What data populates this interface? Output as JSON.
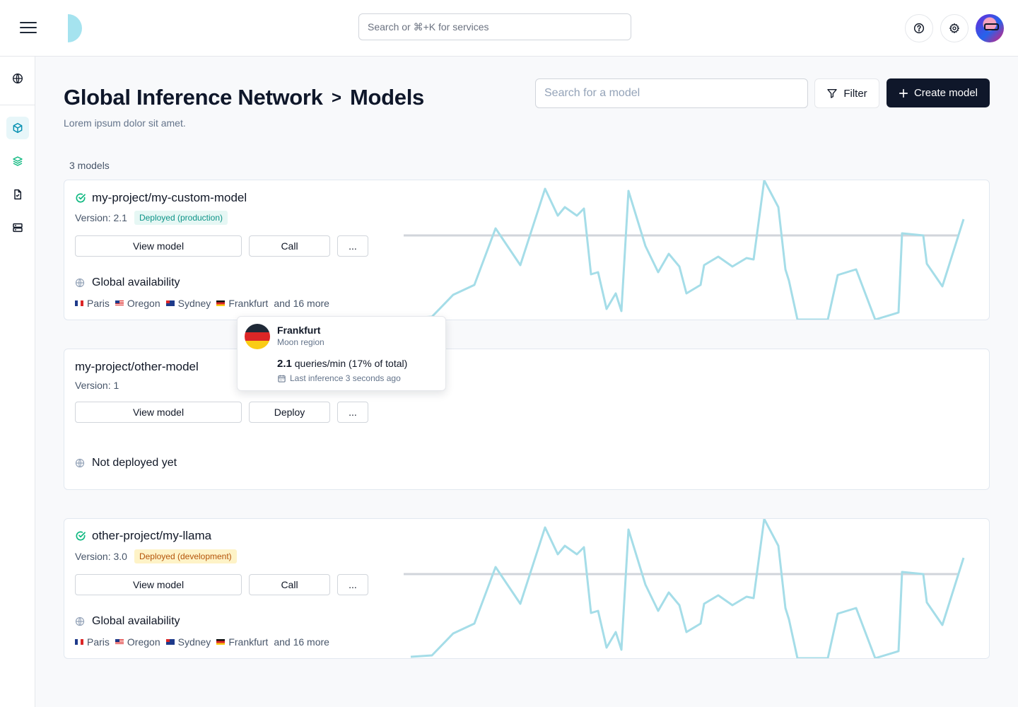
{
  "topbar": {
    "search_placeholder": "Search or ⌘+K for services"
  },
  "sidebar": {
    "items": [
      {
        "name": "globe-icon"
      },
      {
        "name": "cube-icon",
        "active": true
      },
      {
        "name": "layers-icon"
      },
      {
        "name": "file-check-icon"
      },
      {
        "name": "server-icon"
      }
    ]
  },
  "header": {
    "title_prefix": "Global Inference Network",
    "separator": ">",
    "title_current": "Models",
    "subtitle": "Lorem ipsum dolor sit amet.",
    "search_placeholder": "Search for a model",
    "filter_label": "Filter",
    "create_label": "Create model"
  },
  "models_count": "3 models",
  "models": [
    {
      "name": "my-project/my-custom-model",
      "version": "Version: 2.1",
      "badge": "Deployed (production)",
      "primary_action": "View model",
      "secondary_action": "Call",
      "more_action": "...",
      "availability": "Global availability",
      "regions": [
        "Paris",
        "Oregon",
        "Sydney",
        "Frankfurt"
      ],
      "more_regions": "and 16 more"
    },
    {
      "name": "my-project/other-model",
      "version": "Version: 1",
      "primary_action": "View model",
      "secondary_action": "Deploy",
      "more_action": "...",
      "availability": "Not deployed yet"
    },
    {
      "name": "other-project/my-llama",
      "version": "Version: 3.0",
      "badge": "Deployed (development)",
      "primary_action": "View model",
      "secondary_action": "Call",
      "more_action": "...",
      "availability": "Global availability",
      "regions": [
        "Paris",
        "Oregon",
        "Sydney",
        "Frankfurt"
      ],
      "more_regions": "and 16 more"
    }
  ],
  "tooltip": {
    "title": "Frankfurt",
    "subtitle": "Moon region",
    "value": "2.1",
    "value_suffix": "queries/min (17% of total)",
    "last_inference": "Last inference 3 seconds ago"
  },
  "colors": {
    "sparkline": "#a5dde8",
    "baseline": "#d1d5db",
    "accent": "#0891b2",
    "primary_button": "#0f172a",
    "success": "#10b981"
  }
}
